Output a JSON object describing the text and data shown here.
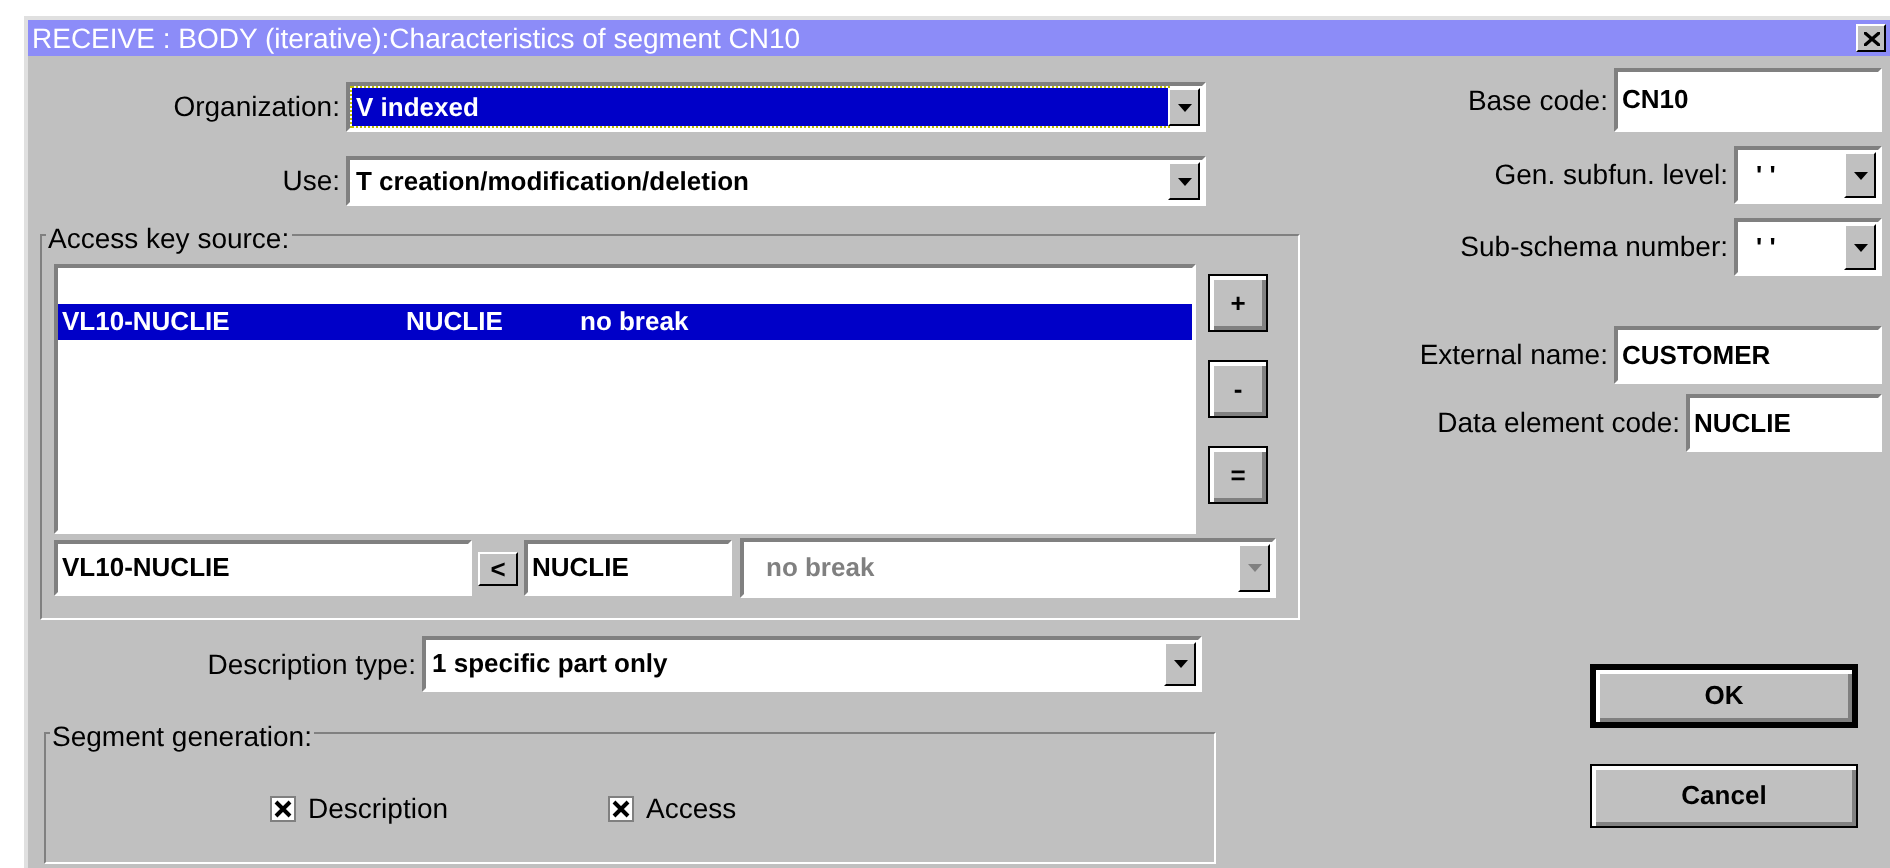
{
  "window": {
    "title": "RECEIVE : BODY (iterative):Characteristics of segment CN10"
  },
  "organization": {
    "label": "Organization:",
    "value": "V indexed",
    "focused": true
  },
  "use": {
    "label": "Use:",
    "value": "T creation/modification/deletion",
    "focused": false
  },
  "access_key_source": {
    "title": "Access key source:",
    "rows": [
      {
        "cells": [
          "VL10-NUCLIE",
          "NUCLIE",
          "no break"
        ],
        "selected": true
      }
    ],
    "side_buttons": [
      "+",
      "-",
      "="
    ],
    "editor": {
      "key": "VL10-NUCLIE",
      "move_button": "<",
      "element": "NUCLIE",
      "break": "no break",
      "break_disabled": true
    }
  },
  "description_type": {
    "label": "Description type:",
    "value": "1 specific part only",
    "focused": false
  },
  "segment_generation": {
    "title": "Segment generation:",
    "options": [
      {
        "label": "Description",
        "checked": true
      },
      {
        "label": "Access",
        "checked": true
      }
    ]
  },
  "base_code": {
    "label": "Base code:",
    "value": "CN10"
  },
  "gen_subfun_level": {
    "label": "Gen. subfun. level:",
    "value": "' '"
  },
  "sub_schema_number": {
    "label": "Sub-schema number:",
    "value": "' '"
  },
  "external_name": {
    "label": "External name:",
    "value": "CUSTOMER"
  },
  "data_element_code": {
    "label": "Data element code:",
    "value": "NUCLIE"
  },
  "buttons": [
    {
      "label": "OK",
      "default": true
    },
    {
      "label": "Cancel",
      "default": false
    }
  ]
}
